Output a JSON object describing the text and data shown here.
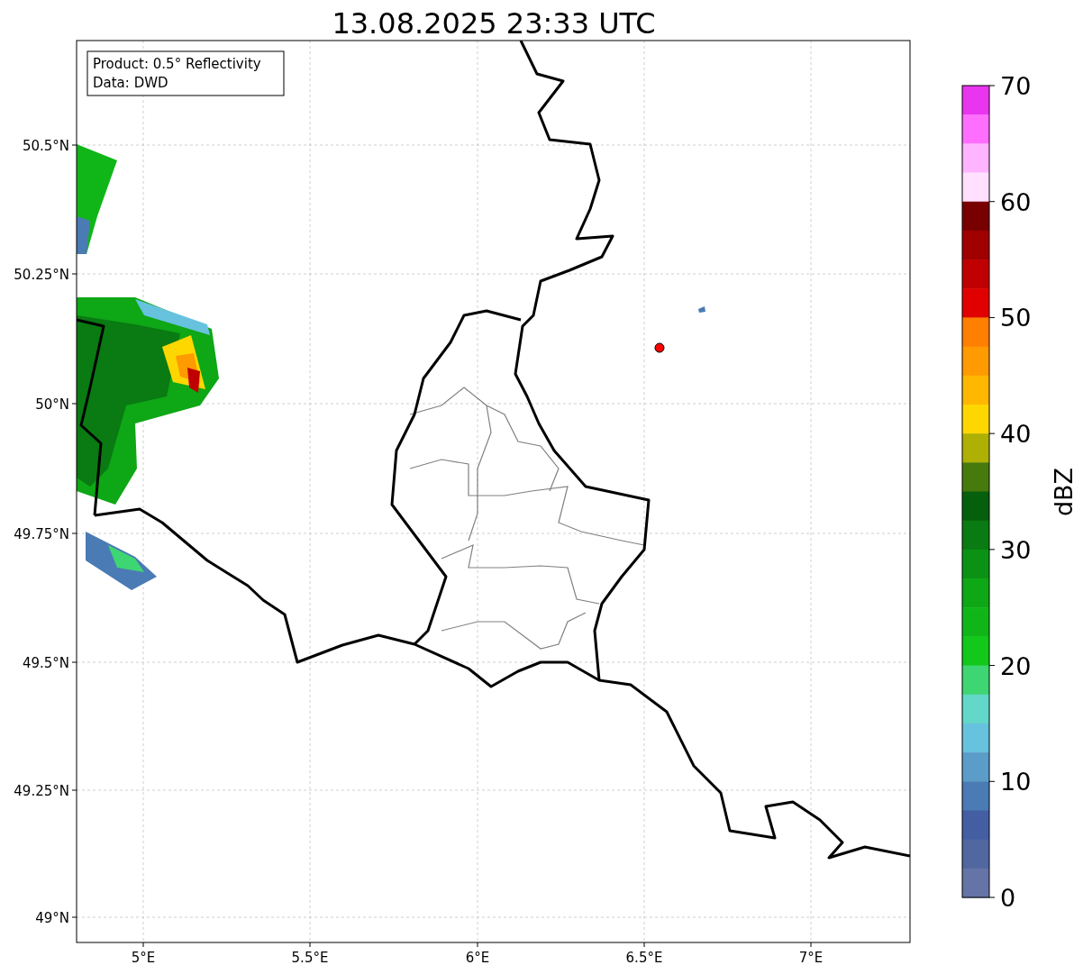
{
  "title": "13.08.2025 23:33 UTC",
  "info_box": [
    "Product: 0.5° Reflectivity",
    "Data: DWD"
  ],
  "x_ticks": [
    "5°E",
    "5.5°E",
    "6°E",
    "6.5°E",
    "7°E"
  ],
  "y_ticks": [
    "50.5°N",
    "50.25°N",
    "50°N",
    "49.75°N",
    "49.5°N",
    "49.25°N",
    "49°N"
  ],
  "colorbar": {
    "label": "dBZ",
    "ticks": [
      "70",
      "60",
      "50",
      "40",
      "30",
      "20",
      "10",
      "0"
    ],
    "levels": [
      {
        "color": "#e935ef"
      },
      {
        "color": "#ff6eff"
      },
      {
        "color": "#ffb4ff"
      },
      {
        "color": "#ffe0ff"
      },
      {
        "color": "#780000"
      },
      {
        "color": "#a00000"
      },
      {
        "color": "#c00000"
      },
      {
        "color": "#e00000"
      },
      {
        "color": "#ff7f00"
      },
      {
        "color": "#ff9a00"
      },
      {
        "color": "#ffb700"
      },
      {
        "color": "#ffd700"
      },
      {
        "color": "#afb004"
      },
      {
        "color": "#477a0c"
      },
      {
        "color": "#065f0c"
      },
      {
        "color": "#0a7a12"
      },
      {
        "color": "#0b9214"
      },
      {
        "color": "#0ea716"
      },
      {
        "color": "#10b618"
      },
      {
        "color": "#12c81a"
      },
      {
        "color": "#3ed672"
      },
      {
        "color": "#63d8c8"
      },
      {
        "color": "#67c2de"
      },
      {
        "color": "#5b9dc8"
      },
      {
        "color": "#4a7bb4"
      },
      {
        "color": "#435ea2"
      },
      {
        "color": "#5067a0"
      },
      {
        "color": "#6574a6"
      }
    ]
  }
}
